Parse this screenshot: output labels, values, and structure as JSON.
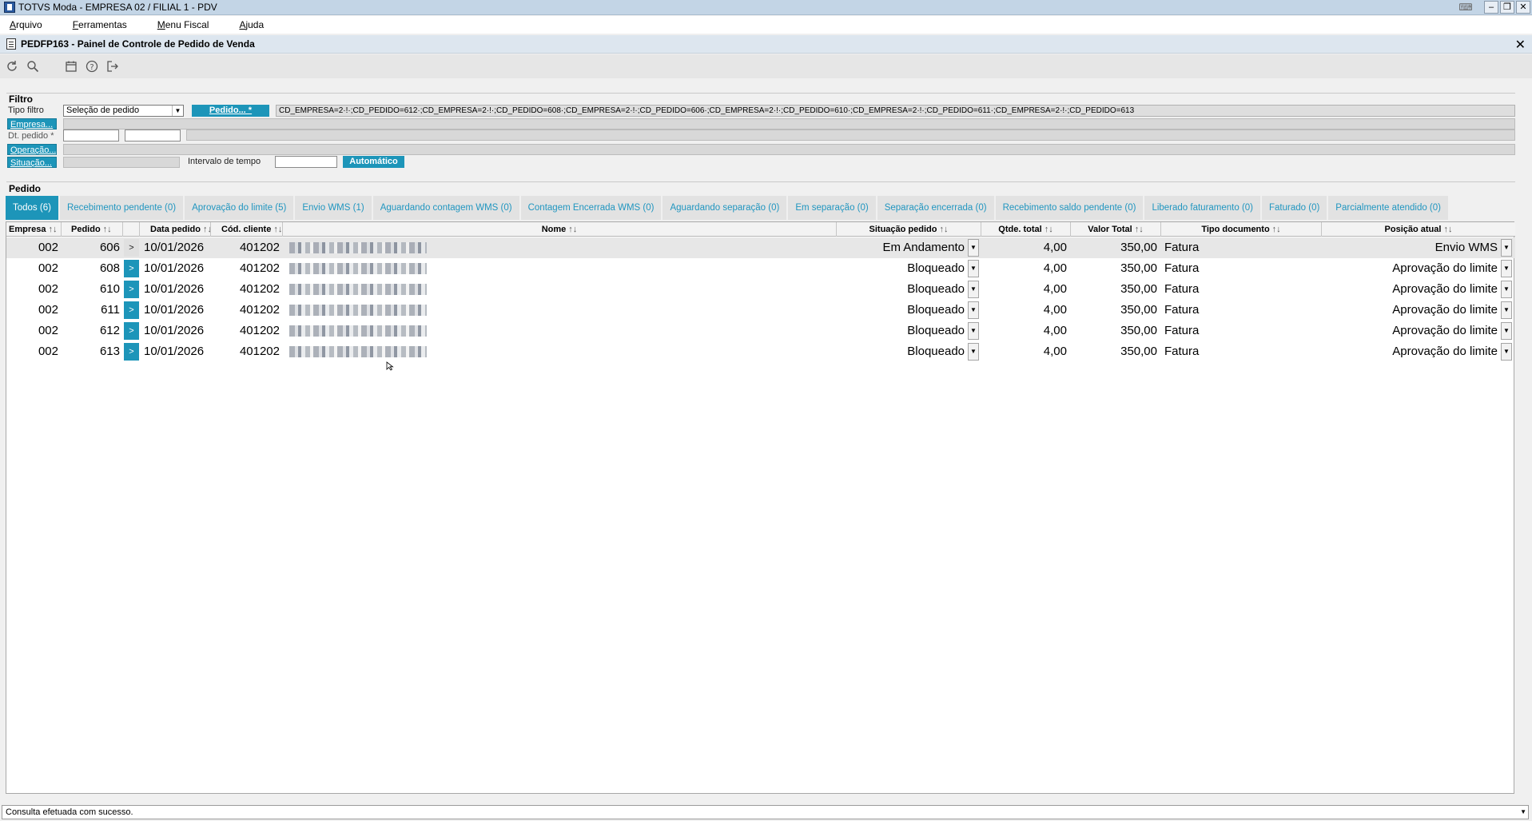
{
  "window": {
    "title": "TOTVS Moda - EMPRESA 02 / FILIAL 1 - PDV"
  },
  "menu": [
    {
      "label": "Arquivo"
    },
    {
      "label": "Ferramentas"
    },
    {
      "label": "Menu Fiscal"
    },
    {
      "label": "Ajuda"
    }
  ],
  "form": {
    "title": "PEDFP163 - Painel de Controle de Pedido de Venda"
  },
  "toolbar": {
    "icons": [
      "refresh-icon",
      "search-icon",
      "calendar-icon",
      "help-icon",
      "exit-icon"
    ]
  },
  "filter": {
    "section_label": "Filtro",
    "tipo_filtro_label": "Tipo filtro",
    "tipo_filtro_value": "Seleção de pedido",
    "pedido_button": "Pedido... *",
    "pedido_filter_text": "CD_EMPRESA=2·!·;CD_PEDIDO=612·;CD_EMPRESA=2·!·;CD_PEDIDO=608·;CD_EMPRESA=2·!·;CD_PEDIDO=606·;CD_EMPRESA=2·!·;CD_PEDIDO=610·;CD_EMPRESA=2·!·;CD_PEDIDO=611·;CD_EMPRESA=2·!·;CD_PEDIDO=613",
    "empresa_label": "Empresa...",
    "dt_pedido_label": "Dt. pedido *",
    "operacao_label": "Operação...",
    "situacao_label": "Situação...",
    "intervalo_label": "Intervalo de tempo",
    "automatico_button": "Automático"
  },
  "pedido_section": {
    "label": "Pedido"
  },
  "tabs": [
    {
      "label": "Todos (6)",
      "active": true
    },
    {
      "label": "Recebimento pendente (0)"
    },
    {
      "label": "Aprovação do limite (5)"
    },
    {
      "label": "Envio WMS (1)"
    },
    {
      "label": "Aguardando contagem WMS (0)"
    },
    {
      "label": "Contagem Encerrada WMS (0)"
    },
    {
      "label": "Aguardando separação (0)"
    },
    {
      "label": "Em separação (0)"
    },
    {
      "label": "Separação encerrada (0)"
    },
    {
      "label": "Recebimento saldo pendente (0)"
    },
    {
      "label": "Liberado faturamento (0)"
    },
    {
      "label": "Faturado (0)"
    },
    {
      "label": "Parcialmente atendido (0)"
    }
  ],
  "grid": {
    "sort_glyph": "↑↓",
    "columns": {
      "empresa": "Empresa",
      "pedido": "Pedido",
      "data_pedido": "Data pedido",
      "cod_cliente": "Cód. cliente",
      "nome": "Nome",
      "situacao": "Situação pedido",
      "qtde": "Qtde. total",
      "valor": "Valor Total",
      "tipo_doc": "Tipo documento",
      "posicao": "Posição atual"
    },
    "expander_glyph": ">",
    "rows": [
      {
        "empresa": "002",
        "pedido": "606",
        "data": "10/01/2026",
        "cliente": "401202",
        "situacao": "Em Andamento",
        "qtde": "4,00",
        "valor": "350,00",
        "tipo": "Fatura",
        "posicao": "Envio WMS",
        "selected": true
      },
      {
        "empresa": "002",
        "pedido": "608",
        "data": "10/01/2026",
        "cliente": "401202",
        "situacao": "Bloqueado",
        "qtde": "4,00",
        "valor": "350,00",
        "tipo": "Fatura",
        "posicao": "Aprovação do limite"
      },
      {
        "empresa": "002",
        "pedido": "610",
        "data": "10/01/2026",
        "cliente": "401202",
        "situacao": "Bloqueado",
        "qtde": "4,00",
        "valor": "350,00",
        "tipo": "Fatura",
        "posicao": "Aprovação do limite"
      },
      {
        "empresa": "002",
        "pedido": "611",
        "data": "10/01/2026",
        "cliente": "401202",
        "situacao": "Bloqueado",
        "qtde": "4,00",
        "valor": "350,00",
        "tipo": "Fatura",
        "posicao": "Aprovação do limite"
      },
      {
        "empresa": "002",
        "pedido": "612",
        "data": "10/01/2026",
        "cliente": "401202",
        "situacao": "Bloqueado",
        "qtde": "4,00",
        "valor": "350,00",
        "tipo": "Fatura",
        "posicao": "Aprovação do limite"
      },
      {
        "empresa": "002",
        "pedido": "613",
        "data": "10/01/2026",
        "cliente": "401202",
        "situacao": "Bloqueado",
        "qtde": "4,00",
        "valor": "350,00",
        "tipo": "Fatura",
        "posicao": "Aprovação do limite"
      }
    ]
  },
  "status": {
    "message": "Consulta efetuada com sucesso."
  },
  "colors": {
    "accent": "#1d95b9",
    "tab_text": "#2196c0",
    "titlebar": "#c3d5e6"
  }
}
